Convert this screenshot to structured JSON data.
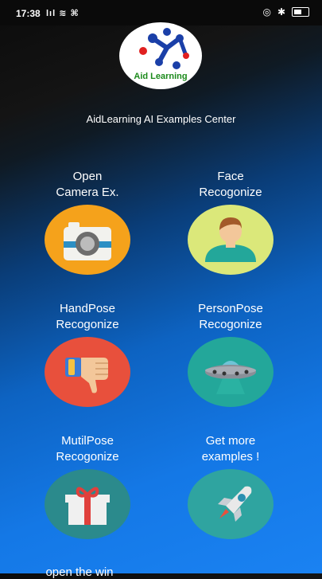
{
  "status_bar": {
    "time": "17:38",
    "signal": "lıl ≋ ⌘"
  },
  "logo": {
    "text": "Aid Learning"
  },
  "app_title": "AidLearning AI Examples Center",
  "tiles": [
    {
      "line1": "Open",
      "line2": "Camera Ex.",
      "color": "#f5a21b"
    },
    {
      "line1": "Face",
      "line2": "Recogonize",
      "color": "#dbe87a"
    },
    {
      "line1": "HandPose",
      "line2": "Recogonize",
      "color": "#e8503c"
    },
    {
      "line1": "PersonPose",
      "line2": "Recogonize",
      "color": "#23a79a"
    },
    {
      "line1": "MutilPose",
      "line2": "Recogonize",
      "color": "#2b8a8c"
    },
    {
      "line1": "Get more",
      "line2": "examples !",
      "color": "#2fa4a0"
    }
  ],
  "partial_label": "open the win"
}
